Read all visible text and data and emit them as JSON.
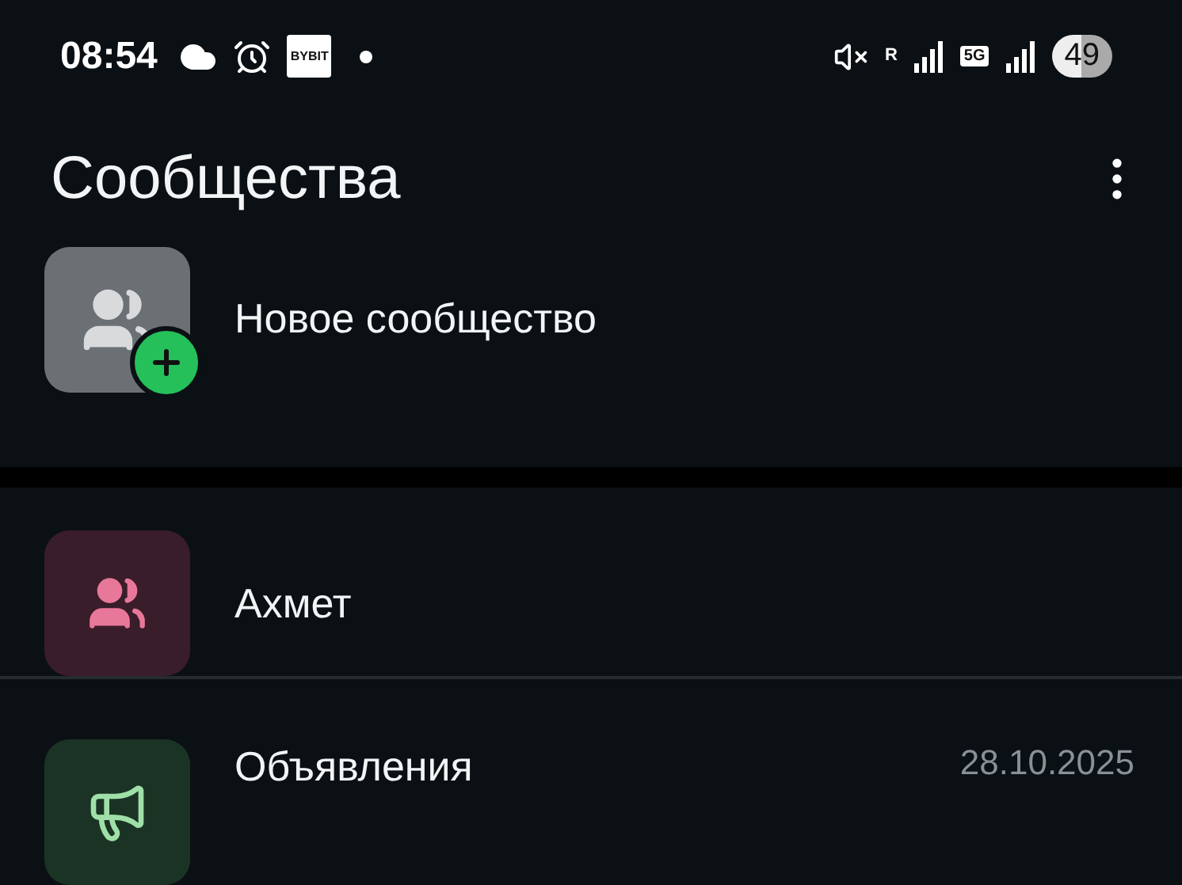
{
  "status_bar": {
    "time": "08:54",
    "app_badge": "BYBIT",
    "roaming": "R",
    "network": "5G",
    "battery": "49"
  },
  "header": {
    "title": "Сообщества"
  },
  "new_community": {
    "label": "Новое сообщество"
  },
  "communities": [
    {
      "kind": "group",
      "name": "Ахмет",
      "color": "#e8789a"
    },
    {
      "kind": "announcements",
      "name": "Объявления",
      "date": "28.10.2025",
      "color": "#9fe0a8"
    }
  ]
}
